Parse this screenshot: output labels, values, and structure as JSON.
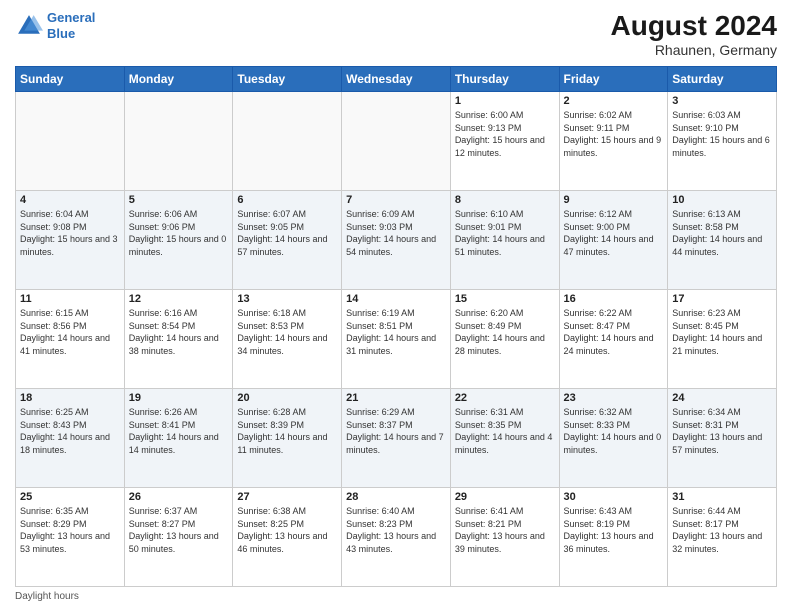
{
  "header": {
    "logo_line1": "General",
    "logo_line2": "Blue",
    "month_year": "August 2024",
    "location": "Rhaunen, Germany"
  },
  "footer": {
    "label": "Daylight hours"
  },
  "days_of_week": [
    "Sunday",
    "Monday",
    "Tuesday",
    "Wednesday",
    "Thursday",
    "Friday",
    "Saturday"
  ],
  "weeks": [
    [
      {
        "day": "",
        "info": ""
      },
      {
        "day": "",
        "info": ""
      },
      {
        "day": "",
        "info": ""
      },
      {
        "day": "",
        "info": ""
      },
      {
        "day": "1",
        "info": "Sunrise: 6:00 AM\nSunset: 9:13 PM\nDaylight: 15 hours and 12 minutes."
      },
      {
        "day": "2",
        "info": "Sunrise: 6:02 AM\nSunset: 9:11 PM\nDaylight: 15 hours and 9 minutes."
      },
      {
        "day": "3",
        "info": "Sunrise: 6:03 AM\nSunset: 9:10 PM\nDaylight: 15 hours and 6 minutes."
      }
    ],
    [
      {
        "day": "4",
        "info": "Sunrise: 6:04 AM\nSunset: 9:08 PM\nDaylight: 15 hours and 3 minutes."
      },
      {
        "day": "5",
        "info": "Sunrise: 6:06 AM\nSunset: 9:06 PM\nDaylight: 15 hours and 0 minutes."
      },
      {
        "day": "6",
        "info": "Sunrise: 6:07 AM\nSunset: 9:05 PM\nDaylight: 14 hours and 57 minutes."
      },
      {
        "day": "7",
        "info": "Sunrise: 6:09 AM\nSunset: 9:03 PM\nDaylight: 14 hours and 54 minutes."
      },
      {
        "day": "8",
        "info": "Sunrise: 6:10 AM\nSunset: 9:01 PM\nDaylight: 14 hours and 51 minutes."
      },
      {
        "day": "9",
        "info": "Sunrise: 6:12 AM\nSunset: 9:00 PM\nDaylight: 14 hours and 47 minutes."
      },
      {
        "day": "10",
        "info": "Sunrise: 6:13 AM\nSunset: 8:58 PM\nDaylight: 14 hours and 44 minutes."
      }
    ],
    [
      {
        "day": "11",
        "info": "Sunrise: 6:15 AM\nSunset: 8:56 PM\nDaylight: 14 hours and 41 minutes."
      },
      {
        "day": "12",
        "info": "Sunrise: 6:16 AM\nSunset: 8:54 PM\nDaylight: 14 hours and 38 minutes."
      },
      {
        "day": "13",
        "info": "Sunrise: 6:18 AM\nSunset: 8:53 PM\nDaylight: 14 hours and 34 minutes."
      },
      {
        "day": "14",
        "info": "Sunrise: 6:19 AM\nSunset: 8:51 PM\nDaylight: 14 hours and 31 minutes."
      },
      {
        "day": "15",
        "info": "Sunrise: 6:20 AM\nSunset: 8:49 PM\nDaylight: 14 hours and 28 minutes."
      },
      {
        "day": "16",
        "info": "Sunrise: 6:22 AM\nSunset: 8:47 PM\nDaylight: 14 hours and 24 minutes."
      },
      {
        "day": "17",
        "info": "Sunrise: 6:23 AM\nSunset: 8:45 PM\nDaylight: 14 hours and 21 minutes."
      }
    ],
    [
      {
        "day": "18",
        "info": "Sunrise: 6:25 AM\nSunset: 8:43 PM\nDaylight: 14 hours and 18 minutes."
      },
      {
        "day": "19",
        "info": "Sunrise: 6:26 AM\nSunset: 8:41 PM\nDaylight: 14 hours and 14 minutes."
      },
      {
        "day": "20",
        "info": "Sunrise: 6:28 AM\nSunset: 8:39 PM\nDaylight: 14 hours and 11 minutes."
      },
      {
        "day": "21",
        "info": "Sunrise: 6:29 AM\nSunset: 8:37 PM\nDaylight: 14 hours and 7 minutes."
      },
      {
        "day": "22",
        "info": "Sunrise: 6:31 AM\nSunset: 8:35 PM\nDaylight: 14 hours and 4 minutes."
      },
      {
        "day": "23",
        "info": "Sunrise: 6:32 AM\nSunset: 8:33 PM\nDaylight: 14 hours and 0 minutes."
      },
      {
        "day": "24",
        "info": "Sunrise: 6:34 AM\nSunset: 8:31 PM\nDaylight: 13 hours and 57 minutes."
      }
    ],
    [
      {
        "day": "25",
        "info": "Sunrise: 6:35 AM\nSunset: 8:29 PM\nDaylight: 13 hours and 53 minutes."
      },
      {
        "day": "26",
        "info": "Sunrise: 6:37 AM\nSunset: 8:27 PM\nDaylight: 13 hours and 50 minutes."
      },
      {
        "day": "27",
        "info": "Sunrise: 6:38 AM\nSunset: 8:25 PM\nDaylight: 13 hours and 46 minutes."
      },
      {
        "day": "28",
        "info": "Sunrise: 6:40 AM\nSunset: 8:23 PM\nDaylight: 13 hours and 43 minutes."
      },
      {
        "day": "29",
        "info": "Sunrise: 6:41 AM\nSunset: 8:21 PM\nDaylight: 13 hours and 39 minutes."
      },
      {
        "day": "30",
        "info": "Sunrise: 6:43 AM\nSunset: 8:19 PM\nDaylight: 13 hours and 36 minutes."
      },
      {
        "day": "31",
        "info": "Sunrise: 6:44 AM\nSunset: 8:17 PM\nDaylight: 13 hours and 32 minutes."
      }
    ]
  ]
}
